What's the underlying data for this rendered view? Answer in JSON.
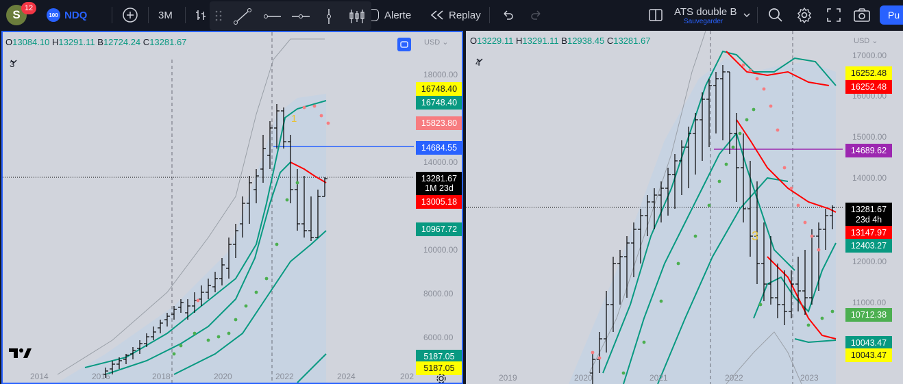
{
  "user": {
    "initial": "S",
    "notifications": "12"
  },
  "symbol": {
    "badge": "100",
    "name": "NDQ"
  },
  "toolbar": {
    "interval": "3M",
    "alert_label": "Alerte",
    "replay_label": "Replay",
    "layout_name": "ATS double B",
    "save_label": "Sauvegarder",
    "publish_label": "Pu"
  },
  "colors": {
    "up": "#089981",
    "down": "#f23645",
    "pane_bg": "#d1d4dc",
    "accent": "#2962ff"
  },
  "left_pane": {
    "ohlc": {
      "o_label": "O",
      "o": "13084.10",
      "h_label": "H",
      "h": "13291.11",
      "b_label": "B",
      "b": "12724.24",
      "c_label": "C",
      "c": "13281.67"
    },
    "legend": "3",
    "currency": "USD",
    "wave_label": "1",
    "y_ticks": [
      "18000.00",
      "14000.00",
      "10000.00",
      "8000.00",
      "6000.00"
    ],
    "x_ticks": [
      "2014",
      "2016",
      "2018",
      "2020",
      "2022",
      "2024",
      "202"
    ],
    "price_labels": [
      {
        "text": "16748.40",
        "bg": "#ffff00",
        "fg": "#131722"
      },
      {
        "text": "16748.40",
        "bg": "#089981",
        "fg": "#ffffff"
      },
      {
        "text": "15823.80",
        "bg": "#f77c80",
        "fg": "#ffffff"
      },
      {
        "text": "14684.55",
        "bg": "#2962ff",
        "fg": "#ffffff"
      },
      {
        "text": "13281.67",
        "bg": "#000000",
        "fg": "#ffffff"
      },
      {
        "text": "1M 23d",
        "bg": "#000000",
        "fg": "#ffffff"
      },
      {
        "text": "13005.18",
        "bg": "#ff0000",
        "fg": "#ffffff"
      },
      {
        "text": "10967.72",
        "bg": "#089981",
        "fg": "#ffffff"
      },
      {
        "text": "5187.05",
        "bg": "#089981",
        "fg": "#ffffff"
      },
      {
        "text": "5187.05",
        "bg": "#ffff00",
        "fg": "#131722"
      }
    ]
  },
  "right_pane": {
    "ohlc": {
      "o_label": "O",
      "o": "13229.11",
      "h_label": "H",
      "h": "13291.11",
      "b_label": "B",
      "b": "12938.45",
      "c_label": "C",
      "c": "13281.67"
    },
    "legend": "4",
    "currency": "USD",
    "wave_label": "3",
    "y_ticks": [
      "17000.00",
      "16000.00",
      "15000.00",
      "14000.00",
      "12000.00",
      "11000.00"
    ],
    "x_ticks": [
      "2019",
      "2020",
      "2021",
      "2022",
      "2023"
    ],
    "price_labels": [
      {
        "text": "16252.48",
        "bg": "#ffff00",
        "fg": "#131722"
      },
      {
        "text": "16252.48",
        "bg": "#ff0000",
        "fg": "#ffffff"
      },
      {
        "text": "14689.62",
        "bg": "#9c27b0",
        "fg": "#ffffff"
      },
      {
        "text": "13281.67",
        "bg": "#000000",
        "fg": "#ffffff"
      },
      {
        "text": "23d 4h",
        "bg": "#000000",
        "fg": "#ffffff"
      },
      {
        "text": "13147.97",
        "bg": "#ff0000",
        "fg": "#ffffff"
      },
      {
        "text": "12403.27",
        "bg": "#089981",
        "fg": "#ffffff"
      },
      {
        "text": "10712.38",
        "bg": "#4caf50",
        "fg": "#ffffff"
      },
      {
        "text": "10043.47",
        "bg": "#089981",
        "fg": "#ffffff"
      },
      {
        "text": "10043.47",
        "bg": "#ffff00",
        "fg": "#131722"
      }
    ]
  }
}
